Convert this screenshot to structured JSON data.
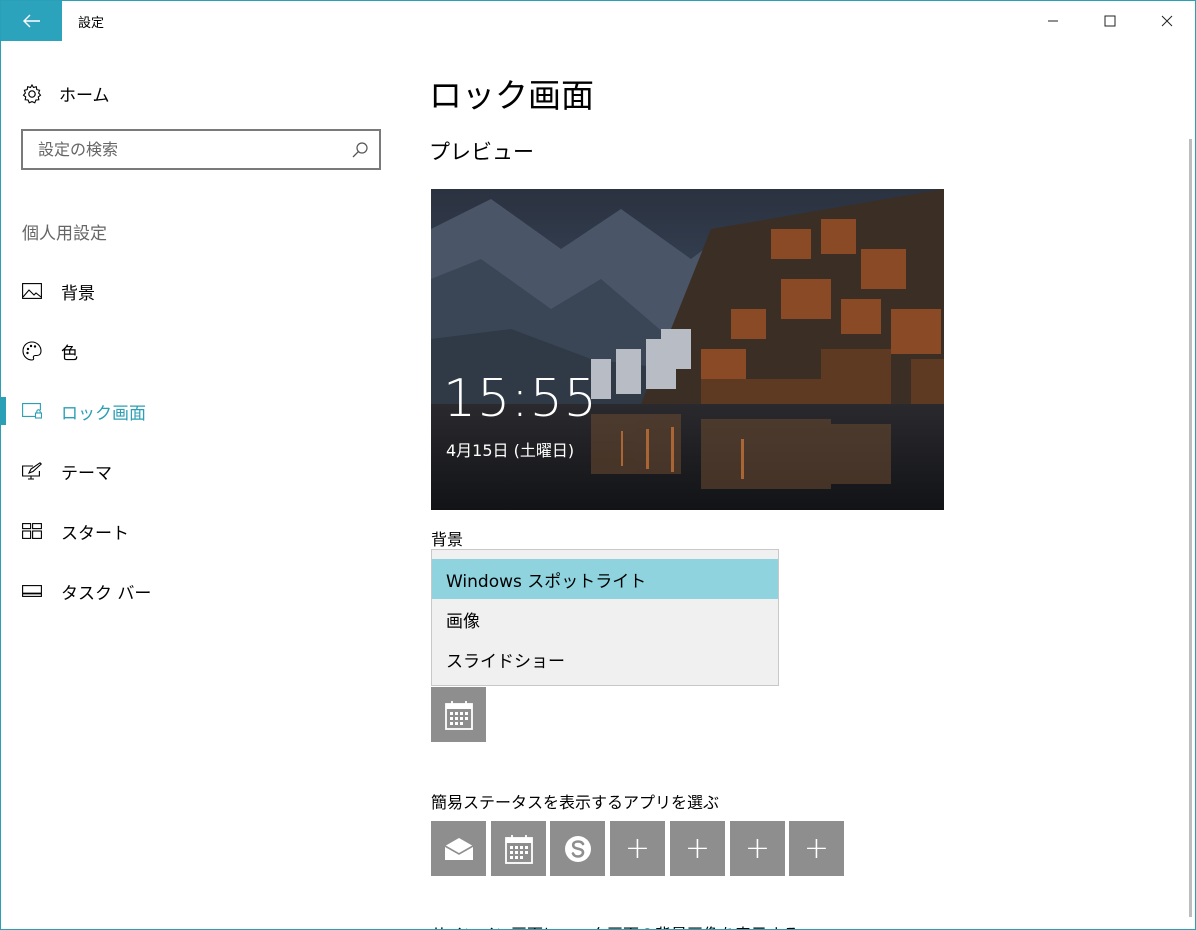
{
  "window": {
    "title": "設定",
    "accent": "#2b9fb5"
  },
  "sidebar": {
    "home_label": "ホーム",
    "search_placeholder": "設定の検索",
    "section_header": "個人用設定",
    "items": [
      {
        "label": "背景",
        "icon": "picture-icon",
        "active": false
      },
      {
        "label": "色",
        "icon": "palette-icon",
        "active": false
      },
      {
        "label": "ロック画面",
        "icon": "lock-screen-icon",
        "active": true
      },
      {
        "label": "テーマ",
        "icon": "theme-icon",
        "active": false
      },
      {
        "label": "スタート",
        "icon": "start-icon",
        "active": false
      },
      {
        "label": "タスク バー",
        "icon": "taskbar-icon",
        "active": false
      }
    ]
  },
  "main": {
    "title": "ロック画面",
    "preview_header": "プレビュー",
    "preview": {
      "time": "15:55",
      "date": "4月15日 (土曜日)"
    },
    "background_label": "背景",
    "background_options": [
      {
        "label": "Windows スポットライト",
        "selected": true
      },
      {
        "label": "画像",
        "selected": false
      },
      {
        "label": "スライドショー",
        "selected": false
      }
    ],
    "detailed_status_app_icon": "calendar-icon",
    "quick_status_header": "簡易ステータスを表示するアプリを選ぶ",
    "quick_status_apps": [
      "mail-icon",
      "calendar-icon",
      "skype-icon",
      "plus-icon",
      "plus-icon",
      "plus-icon",
      "plus-icon"
    ],
    "signin_text": "サインイン画面にロック画面の背景画像を表示する"
  }
}
